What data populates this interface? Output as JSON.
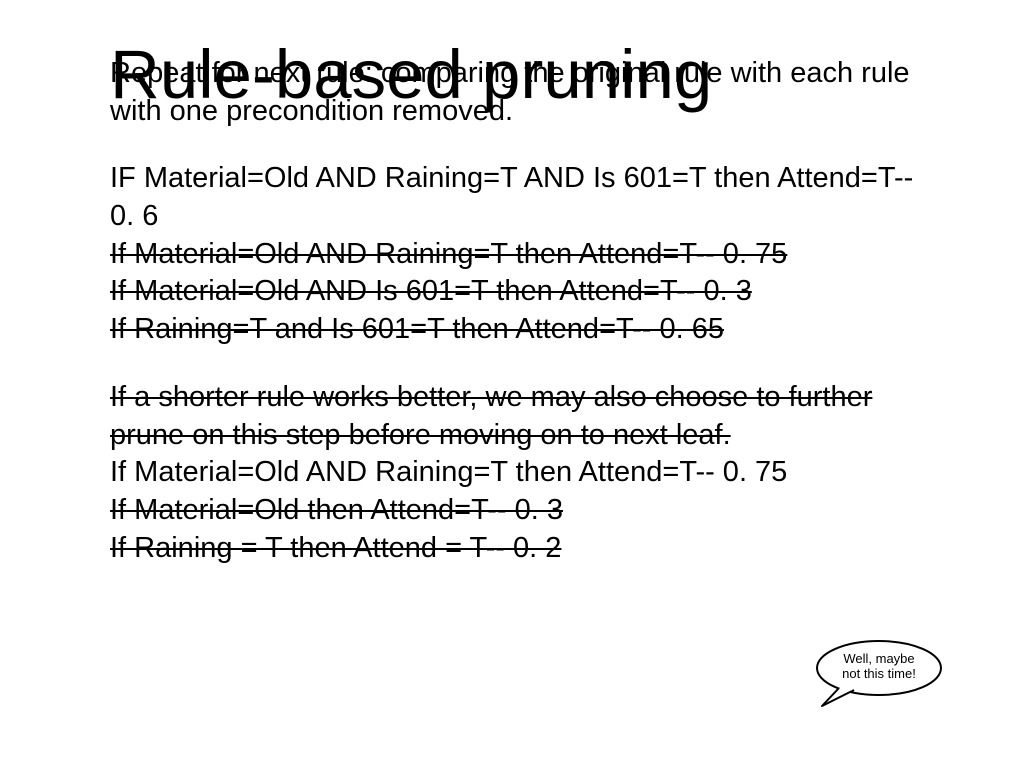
{
  "title": "Rule-based pruning",
  "intro": "Repeat for next rule: comparing the original rule with each rule with one precondition removed.",
  "rules1": [
    "IF Material=Old AND Raining=T AND Is 601=T then Attend=T-- 0. 6",
    "If Material=Old AND Raining=T then Attend=T-- 0. 75",
    "If Material=Old AND Is 601=T then Attend=T-- 0. 3",
    "If Raining=T and Is 601=T then Attend=T-- 0. 65"
  ],
  "mid": "If a shorter rule works better, we may also choose to further prune on this step before moving on to next leaf.",
  "rules2": [
    "If Material=Old AND Raining=T then Attend=T-- 0. 75",
    "If Material=Old then Attend=T-- 0. 3",
    "If Raining = T then Attend = T-- 0. 2"
  ],
  "bubble": {
    "line1": "Well, maybe",
    "line2": "not this time!"
  }
}
